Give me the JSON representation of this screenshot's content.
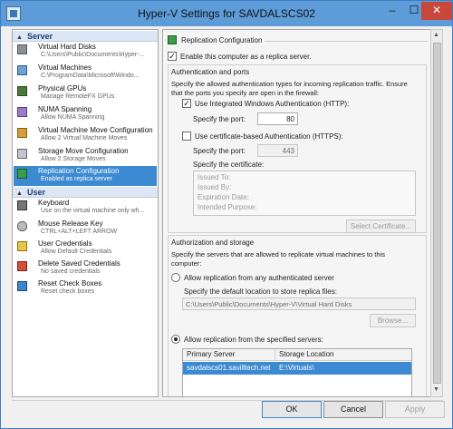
{
  "window": {
    "title": "Hyper-V Settings for SAVDALSCS02"
  },
  "titlebar": {
    "minimize": "–",
    "maximize": "☐",
    "close": "✕"
  },
  "sidebar": {
    "sections": [
      {
        "label": "Server",
        "arrow": "▲"
      },
      {
        "label": "User",
        "arrow": "▲"
      }
    ],
    "items": [
      {
        "label": "Virtual Hard Disks",
        "sub": "C:\\Users\\Public\\Documents\\Hyper-..."
      },
      {
        "label": "Virtual Machines",
        "sub": "C:\\ProgramData\\Microsoft\\Windo..."
      },
      {
        "label": "Physical GPUs",
        "sub": "Manage RemoteFX GPUs"
      },
      {
        "label": "NUMA Spanning",
        "sub": "Allow NUMA Spanning"
      },
      {
        "label": "Virtual Machine Move Configuration",
        "sub": "Allow 2 Virtual Machine Moves"
      },
      {
        "label": "Storage Move Configuration",
        "sub": "Allow 2 Storage Moves"
      },
      {
        "label": "Replication Configuration",
        "sub": "Enabled as replica server"
      },
      {
        "label": "Keyboard",
        "sub": "Use on the virtual machine only wh..."
      },
      {
        "label": "Mouse Release Key",
        "sub": "CTRL+ALT+LEFT ARROW"
      },
      {
        "label": "User Credentials",
        "sub": "Allow Default Credentials"
      },
      {
        "label": "Delete Saved Credentials",
        "sub": "No saved credentials"
      },
      {
        "label": "Reset Check Boxes",
        "sub": "Reset check boxes"
      }
    ]
  },
  "main": {
    "header": "Replication Configuration",
    "enable_checkbox": {
      "label": "Enable this computer as a replica server.",
      "checked": true
    },
    "auth": {
      "title": "Authentication and ports",
      "desc1": "Specify the allowed authentication types for incoming replication traffic. Ensure",
      "desc2": "that the ports you specify are open in the firewall:",
      "http_label": "Use Integrated Windows Authentication (HTTP):",
      "http_checked": true,
      "http_port_label": "Specify the port:",
      "http_port": "80",
      "https_label": "Use certificate-based Authentication (HTTPS):",
      "https_checked": false,
      "https_port_label": "Specify the port:",
      "https_port": "443",
      "cert_label": "Specify the certificate:",
      "cert_fields": [
        "Issued To:",
        "Issued By:",
        "Expiration Date:",
        "Intended Purpose:"
      ],
      "select_cert_button": "Select Certificate..."
    },
    "storage": {
      "title": "Authorization and storage",
      "desc1": "Specify the servers that are allowed to replicate virtual machines to this",
      "desc2": "computer:",
      "radio_any": "Allow replication from any authenticated server",
      "default_location_label": "Specify the default location to store replica files:",
      "default_location": "C:\\Users\\Public\\Documents\\Hyper-V\\Virtual Hard Disks",
      "browse_button": "Browse...",
      "radio_specified": "Allow replication from the specified servers:",
      "table": {
        "columns": [
          "Primary Server",
          "Storage Location"
        ],
        "rows": [
          {
            "server": "savdalscs01.savilltech.net",
            "location": "E:\\Virtuals\\"
          }
        ]
      }
    }
  },
  "scrollbar": {
    "up": "▲",
    "down": "▼"
  },
  "buttons": {
    "ok": "OK",
    "cancel": "Cancel",
    "apply": "Apply"
  }
}
